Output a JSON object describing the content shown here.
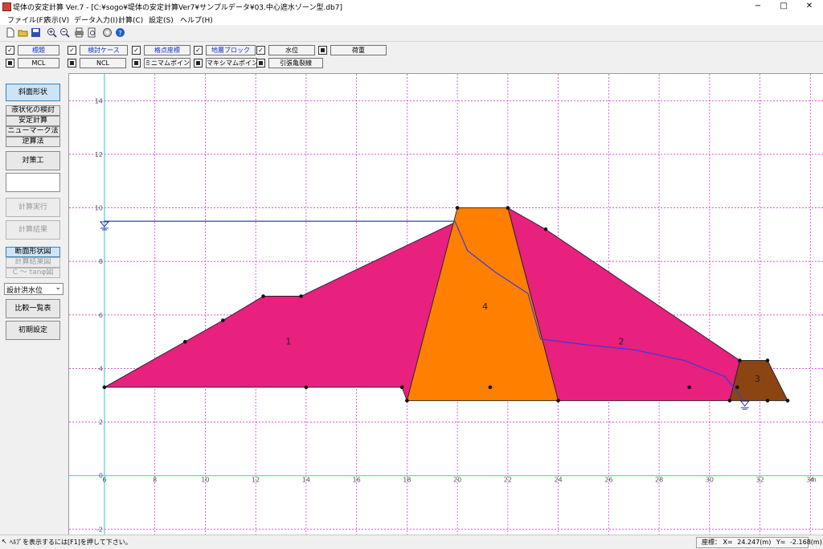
{
  "window": {
    "title": "堤体の安定計算 Ver.7 - [C:¥sogo¥堤体の安定計算Ver7¥サンプルデータ¥03.中心遮水ゾーン型.db7]",
    "controls": [
      "−",
      "□",
      "✕"
    ]
  },
  "menu": [
    "ファイル(F)",
    "表示(V)",
    "データ入力(I)",
    "計算(C)",
    "設定(S)",
    "ヘルプ(H)"
  ],
  "toolbar_icons": [
    "new-icon",
    "open-icon",
    "save-icon",
    "zoom-in-icon",
    "zoom-out-icon",
    "print-icon",
    "print-preview-icon",
    "settings-icon",
    "help-icon"
  ],
  "layer_row1": [
    {
      "label": "標題",
      "checked": true,
      "blue": true
    },
    {
      "label": "検討ケース",
      "checked": true,
      "blue": true
    },
    {
      "label": "格点座標",
      "checked": true,
      "blue": true
    },
    {
      "label": "地層ブロック",
      "checked": true,
      "blue": true
    },
    {
      "label": "水位",
      "checked": true,
      "blue": false
    },
    {
      "label": "荷重",
      "checked": false,
      "blue": false
    }
  ],
  "layer_row2": [
    {
      "label": "MCL",
      "checked": false
    },
    {
      "label": "NCL",
      "checked": false
    },
    {
      "label": "ミニマムポイント",
      "checked": false
    },
    {
      "label": "マキシマムポイント",
      "checked": false
    },
    {
      "label": "引張亀裂線",
      "checked": false
    }
  ],
  "sidebar": {
    "slope_shape": "斜面形状",
    "liquefaction": "液状化の検討",
    "stability": "安定計算",
    "newmark": "ニューマーク法",
    "inverse": "逆算法",
    "countermeasure": "対策工",
    "run_calc": "計算実行",
    "calc_result": "計算結果",
    "section_view": "断面形状図",
    "result_view": "計算結果図",
    "c_tan_view": "C ～ tanφ図",
    "water_level": "設計洪水位",
    "compare_table": "比較一覧表",
    "init_settings": "初期設定"
  },
  "chart_data": {
    "type": "cross-section",
    "x_ticks": [
      6,
      8,
      10,
      12,
      14,
      16,
      18,
      20,
      22,
      24,
      26,
      28,
      30,
      32,
      34
    ],
    "y_ticks": [
      -2,
      0,
      2,
      4,
      6,
      8,
      10,
      12,
      14
    ],
    "x_unit": "m",
    "xlim": [
      4.6,
      34.5
    ],
    "ylim": [
      -2.2,
      15.0
    ],
    "grid": "dashed magenta",
    "axis_color": "#40d8e0",
    "blocks": [
      {
        "id": "1",
        "color": "#e8207e",
        "points": [
          [
            6,
            3.3
          ],
          [
            9.2,
            5.0
          ],
          [
            10.7,
            5.8
          ],
          [
            12.3,
            6.7
          ],
          [
            13.8,
            6.7
          ],
          [
            20,
            9.5
          ],
          [
            18,
            2.8
          ],
          [
            17.8,
            3.3
          ]
        ],
        "label_at": [
          13.3,
          4.9
        ]
      },
      {
        "id": "2",
        "color": "#e8207e",
        "points": [
          [
            22,
            10
          ],
          [
            23.5,
            9.2
          ],
          [
            31.2,
            4.3
          ],
          [
            30.8,
            2.8
          ],
          [
            24,
            2.8
          ]
        ],
        "label_at": [
          26.5,
          4.9
        ]
      },
      {
        "id": "3",
        "color": "#8b4513",
        "points": [
          [
            31.2,
            4.3
          ],
          [
            32.3,
            4.3
          ],
          [
            33.1,
            2.8
          ],
          [
            30.8,
            2.8
          ]
        ],
        "label_at": [
          31.9,
          3.5
        ]
      },
      {
        "id": "4",
        "color": "#ff7f00",
        "points": [
          [
            20,
            10
          ],
          [
            22,
            10
          ],
          [
            24,
            2.8
          ],
          [
            18,
            2.8
          ]
        ],
        "label_at": [
          21.1,
          6.2
        ]
      }
    ],
    "nodes": [
      [
        6,
        3.3
      ],
      [
        9.2,
        5.0
      ],
      [
        10.7,
        5.8
      ],
      [
        12.3,
        6.7
      ],
      [
        13.8,
        6.7
      ],
      [
        14,
        3.3
      ],
      [
        17.8,
        3.3
      ],
      [
        18,
        2.8
      ],
      [
        20,
        10
      ],
      [
        22,
        10
      ],
      [
        23.5,
        9.2
      ],
      [
        24,
        2.8
      ],
      [
        21.3,
        3.3
      ],
      [
        29.2,
        3.3
      ],
      [
        31.2,
        4.3
      ],
      [
        32.3,
        4.3
      ],
      [
        31.1,
        3.3
      ],
      [
        30.8,
        2.8
      ],
      [
        32.3,
        2.8
      ],
      [
        33.1,
        2.8
      ]
    ],
    "water_level_upstream": 9.5,
    "phreatic_line": [
      [
        6,
        9.5
      ],
      [
        19.9,
        9.5
      ],
      [
        20.4,
        8.4
      ],
      [
        21.5,
        7.6
      ],
      [
        22.8,
        6.8
      ],
      [
        23.3,
        5.1
      ],
      [
        25,
        4.9
      ],
      [
        27,
        4.7
      ],
      [
        29,
        4.3
      ],
      [
        30.6,
        3.7
      ],
      [
        31.2,
        3.0
      ],
      [
        31.3,
        2.8
      ]
    ]
  },
  "status": {
    "message": "ﾍﾙﾌﾟを表示するには[F1]を押して下さい。",
    "coord_label": "座標：",
    "coord_x_label": "X=",
    "coord_x": "24.247(m)",
    "coord_y_label": "Y=",
    "coord_y": "-2.168(m)"
  }
}
